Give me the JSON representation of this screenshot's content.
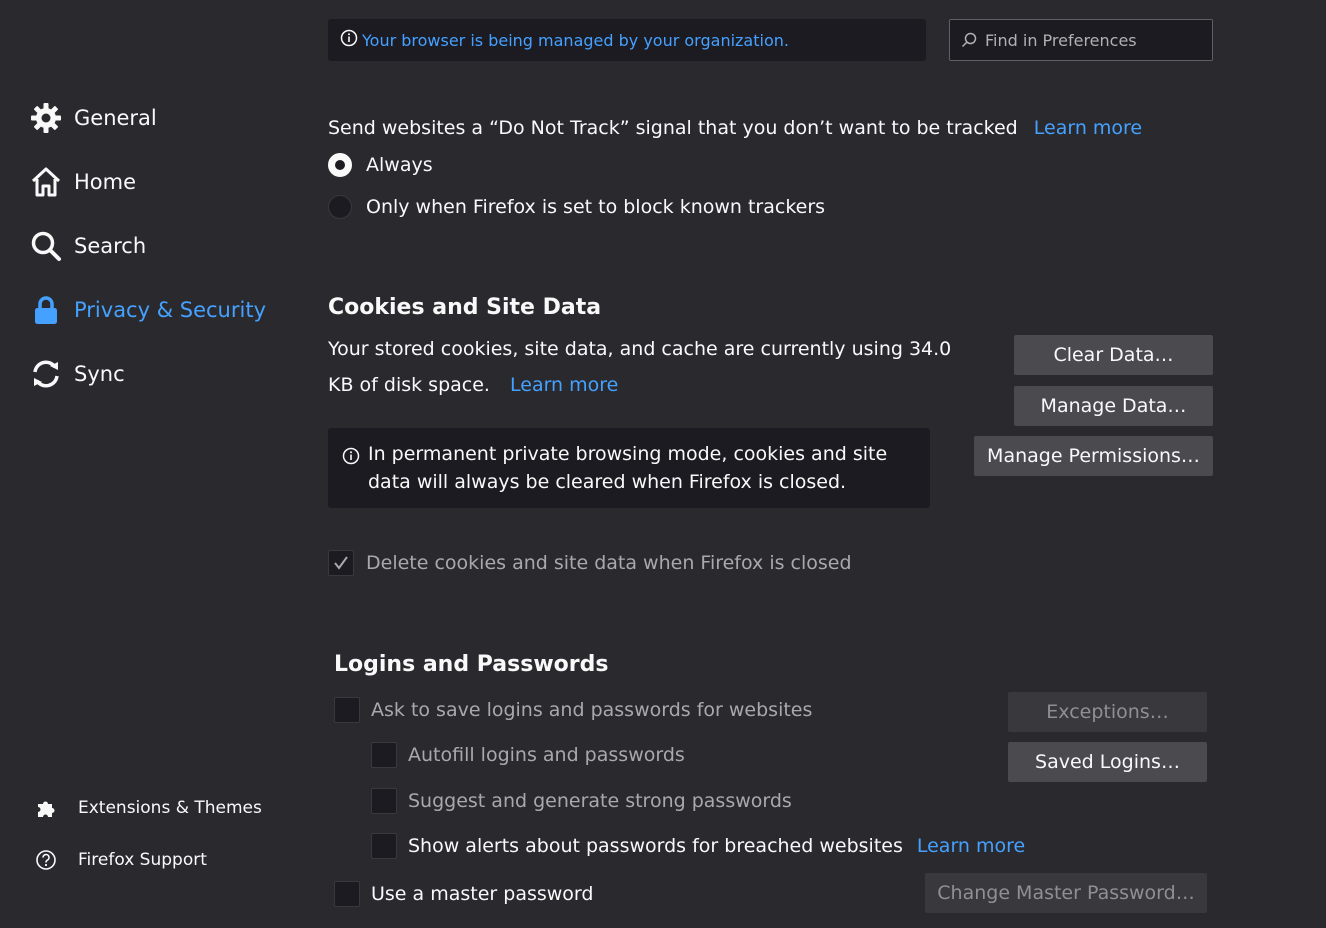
{
  "sidebar": {
    "items": [
      {
        "label": "General",
        "icon": "gear-icon"
      },
      {
        "label": "Home",
        "icon": "home-icon"
      },
      {
        "label": "Search",
        "icon": "search-icon"
      },
      {
        "label": "Privacy & Security",
        "icon": "lock-icon",
        "selected": true
      },
      {
        "label": "Sync",
        "icon": "sync-icon"
      }
    ],
    "footer": [
      {
        "label": "Extensions & Themes",
        "icon": "puzzle-icon"
      },
      {
        "label": "Firefox Support",
        "icon": "help-icon"
      }
    ]
  },
  "header": {
    "managed_notice": "Your browser is being managed by your organization.",
    "search_placeholder": "Find in Preferences"
  },
  "dnt": {
    "label": "Send websites a “Do Not Track” signal that you don’t want to be tracked",
    "learn_more": "Learn more",
    "options": [
      {
        "label": "Always",
        "selected": true
      },
      {
        "label": "Only when Firefox is set to block known trackers",
        "selected": false
      }
    ]
  },
  "cookies": {
    "heading": "Cookies and Site Data",
    "usage_line1": "Your stored cookies, site data, and cache are currently using 34.0",
    "usage_line2": "KB of disk space.",
    "learn_more": "Learn more",
    "buttons": {
      "clear": "Clear Data…",
      "manage": "Manage Data…",
      "permissions": "Manage Permissions…"
    },
    "note": "In permanent private browsing mode, cookies and site data will always be cleared when Firefox is closed.",
    "delete_on_close": {
      "label": "Delete cookies and site data when Firefox is closed",
      "checked": true,
      "disabled": true
    }
  },
  "logins": {
    "heading": "Logins and Passwords",
    "ask_to_save": {
      "label": "Ask to save logins and passwords for websites",
      "checked": false
    },
    "autofill": {
      "label": "Autofill logins and passwords",
      "checked": false
    },
    "suggest": {
      "label": "Suggest and generate strong passwords",
      "checked": false
    },
    "breach_alerts": {
      "label": "Show alerts about passwords for breached websites",
      "checked": false
    },
    "breach_learn_more": "Learn more",
    "master_password": {
      "label": "Use a master password",
      "checked": false
    },
    "buttons": {
      "exceptions": "Exceptions…",
      "saved_logins": "Saved Logins…",
      "change_master": "Change Master Password…"
    }
  },
  "colors": {
    "accent": "#45a1ff",
    "background": "#2a2a2e",
    "button": "#4a4a4f"
  }
}
